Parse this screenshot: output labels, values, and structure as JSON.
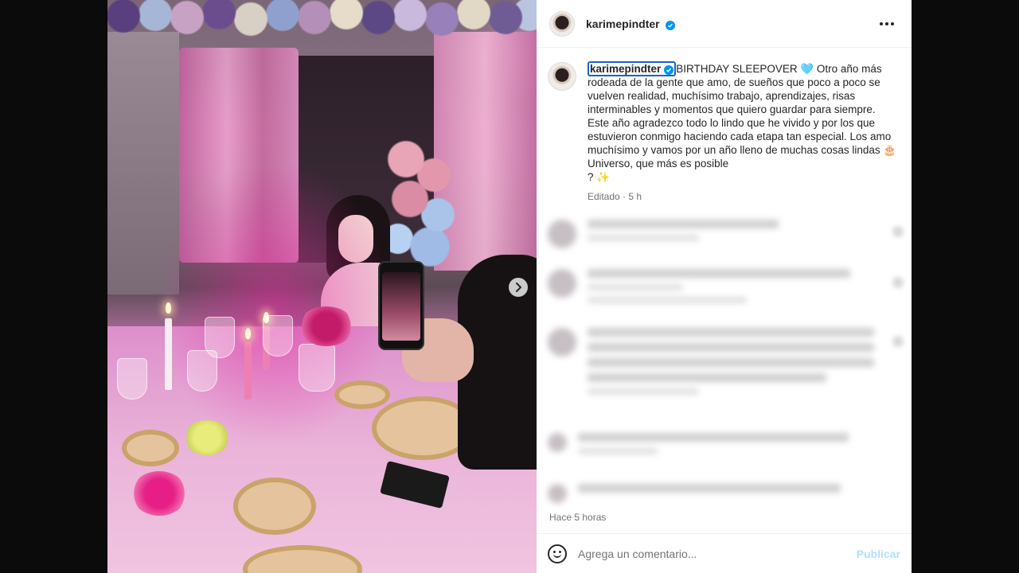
{
  "post": {
    "username": "karimepindter",
    "caption": {
      "username": "karimepindter",
      "text": "BIRTHDAY SLEEPOVER 🩵 Otro año más rodeada de la gente que amo, de sueños que poco a poco se vuelven realidad, muchísimo trabajo, aprendizajes, risas interminables y momentos que quiero guardar para siempre. Este año agradezco todo lo lindo que he vivido y por los que estuvieron conmigo haciendo cada etapa tan especial. Los amo muchísimo y vamos por un año lleno de muchas cosas lindas 🎂 Universo, que más es posible",
      "text_end": "? ✨",
      "edited": "Editado",
      "time": "5 h"
    },
    "time_ago": "Hace 5 horas"
  },
  "comment_bar": {
    "placeholder": "Agrega un comentario...",
    "publish_label": "Publicar"
  },
  "icons": {
    "verified": "verified-badge-icon",
    "more": "more-options-icon",
    "emoji": "emoji-icon",
    "next": "chevron-right-icon"
  },
  "colors": {
    "verified": "#0095f6",
    "publish": "#b2dffc",
    "meta": "#737373"
  }
}
